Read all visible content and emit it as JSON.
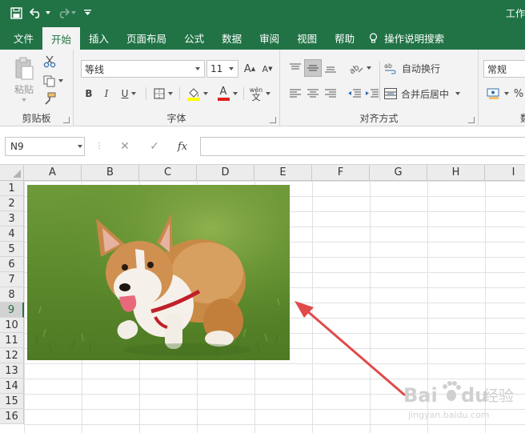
{
  "title": "工作",
  "quick_access": {
    "save_icon": "save-icon",
    "undo_icon": "undo-icon",
    "redo_icon": "redo-icon",
    "customize_icon": "customize-qat-icon"
  },
  "tabs": [
    {
      "label": "文件",
      "active": false
    },
    {
      "label": "开始",
      "active": true
    },
    {
      "label": "插入",
      "active": false
    },
    {
      "label": "页面布局",
      "active": false
    },
    {
      "label": "公式",
      "active": false
    },
    {
      "label": "数据",
      "active": false
    },
    {
      "label": "审阅",
      "active": false
    },
    {
      "label": "视图",
      "active": false
    },
    {
      "label": "帮助",
      "active": false
    }
  ],
  "tell_me": "操作说明搜索",
  "ribbon": {
    "clipboard": {
      "label": "剪贴板",
      "paste": "粘贴"
    },
    "font": {
      "label": "字体",
      "font_name": "等线",
      "font_size": "11",
      "bold": "B",
      "italic": "I",
      "underline": "U",
      "grow": "A",
      "shrink": "A",
      "font_color_letter": "A",
      "phonetic": "wén"
    },
    "alignment": {
      "label": "对齐方式",
      "wrap_text": "自动换行",
      "merge_center": "合并后居中"
    },
    "number": {
      "format": "常规",
      "percent": "%",
      "label_partial": "数"
    }
  },
  "formula_bar": {
    "name_box": "N9",
    "fx": "fx",
    "value": ""
  },
  "columns": [
    "A",
    "B",
    "C",
    "D",
    "E",
    "F",
    "G",
    "H",
    "I"
  ],
  "rows": [
    "1",
    "2",
    "3",
    "4",
    "5",
    "6",
    "7",
    "8",
    "9",
    "10",
    "11",
    "12",
    "13",
    "14",
    "15",
    "16"
  ],
  "selected_row": "9",
  "colors": {
    "excel_green": "#217346",
    "arrow_red": "#e04a4a"
  },
  "picture": {
    "subject": "corgi-puppy-photo"
  },
  "watermark": {
    "brand": "Bai",
    "brand2": "du",
    "suffix": "经验",
    "url": "jingyan.baidu.com"
  }
}
